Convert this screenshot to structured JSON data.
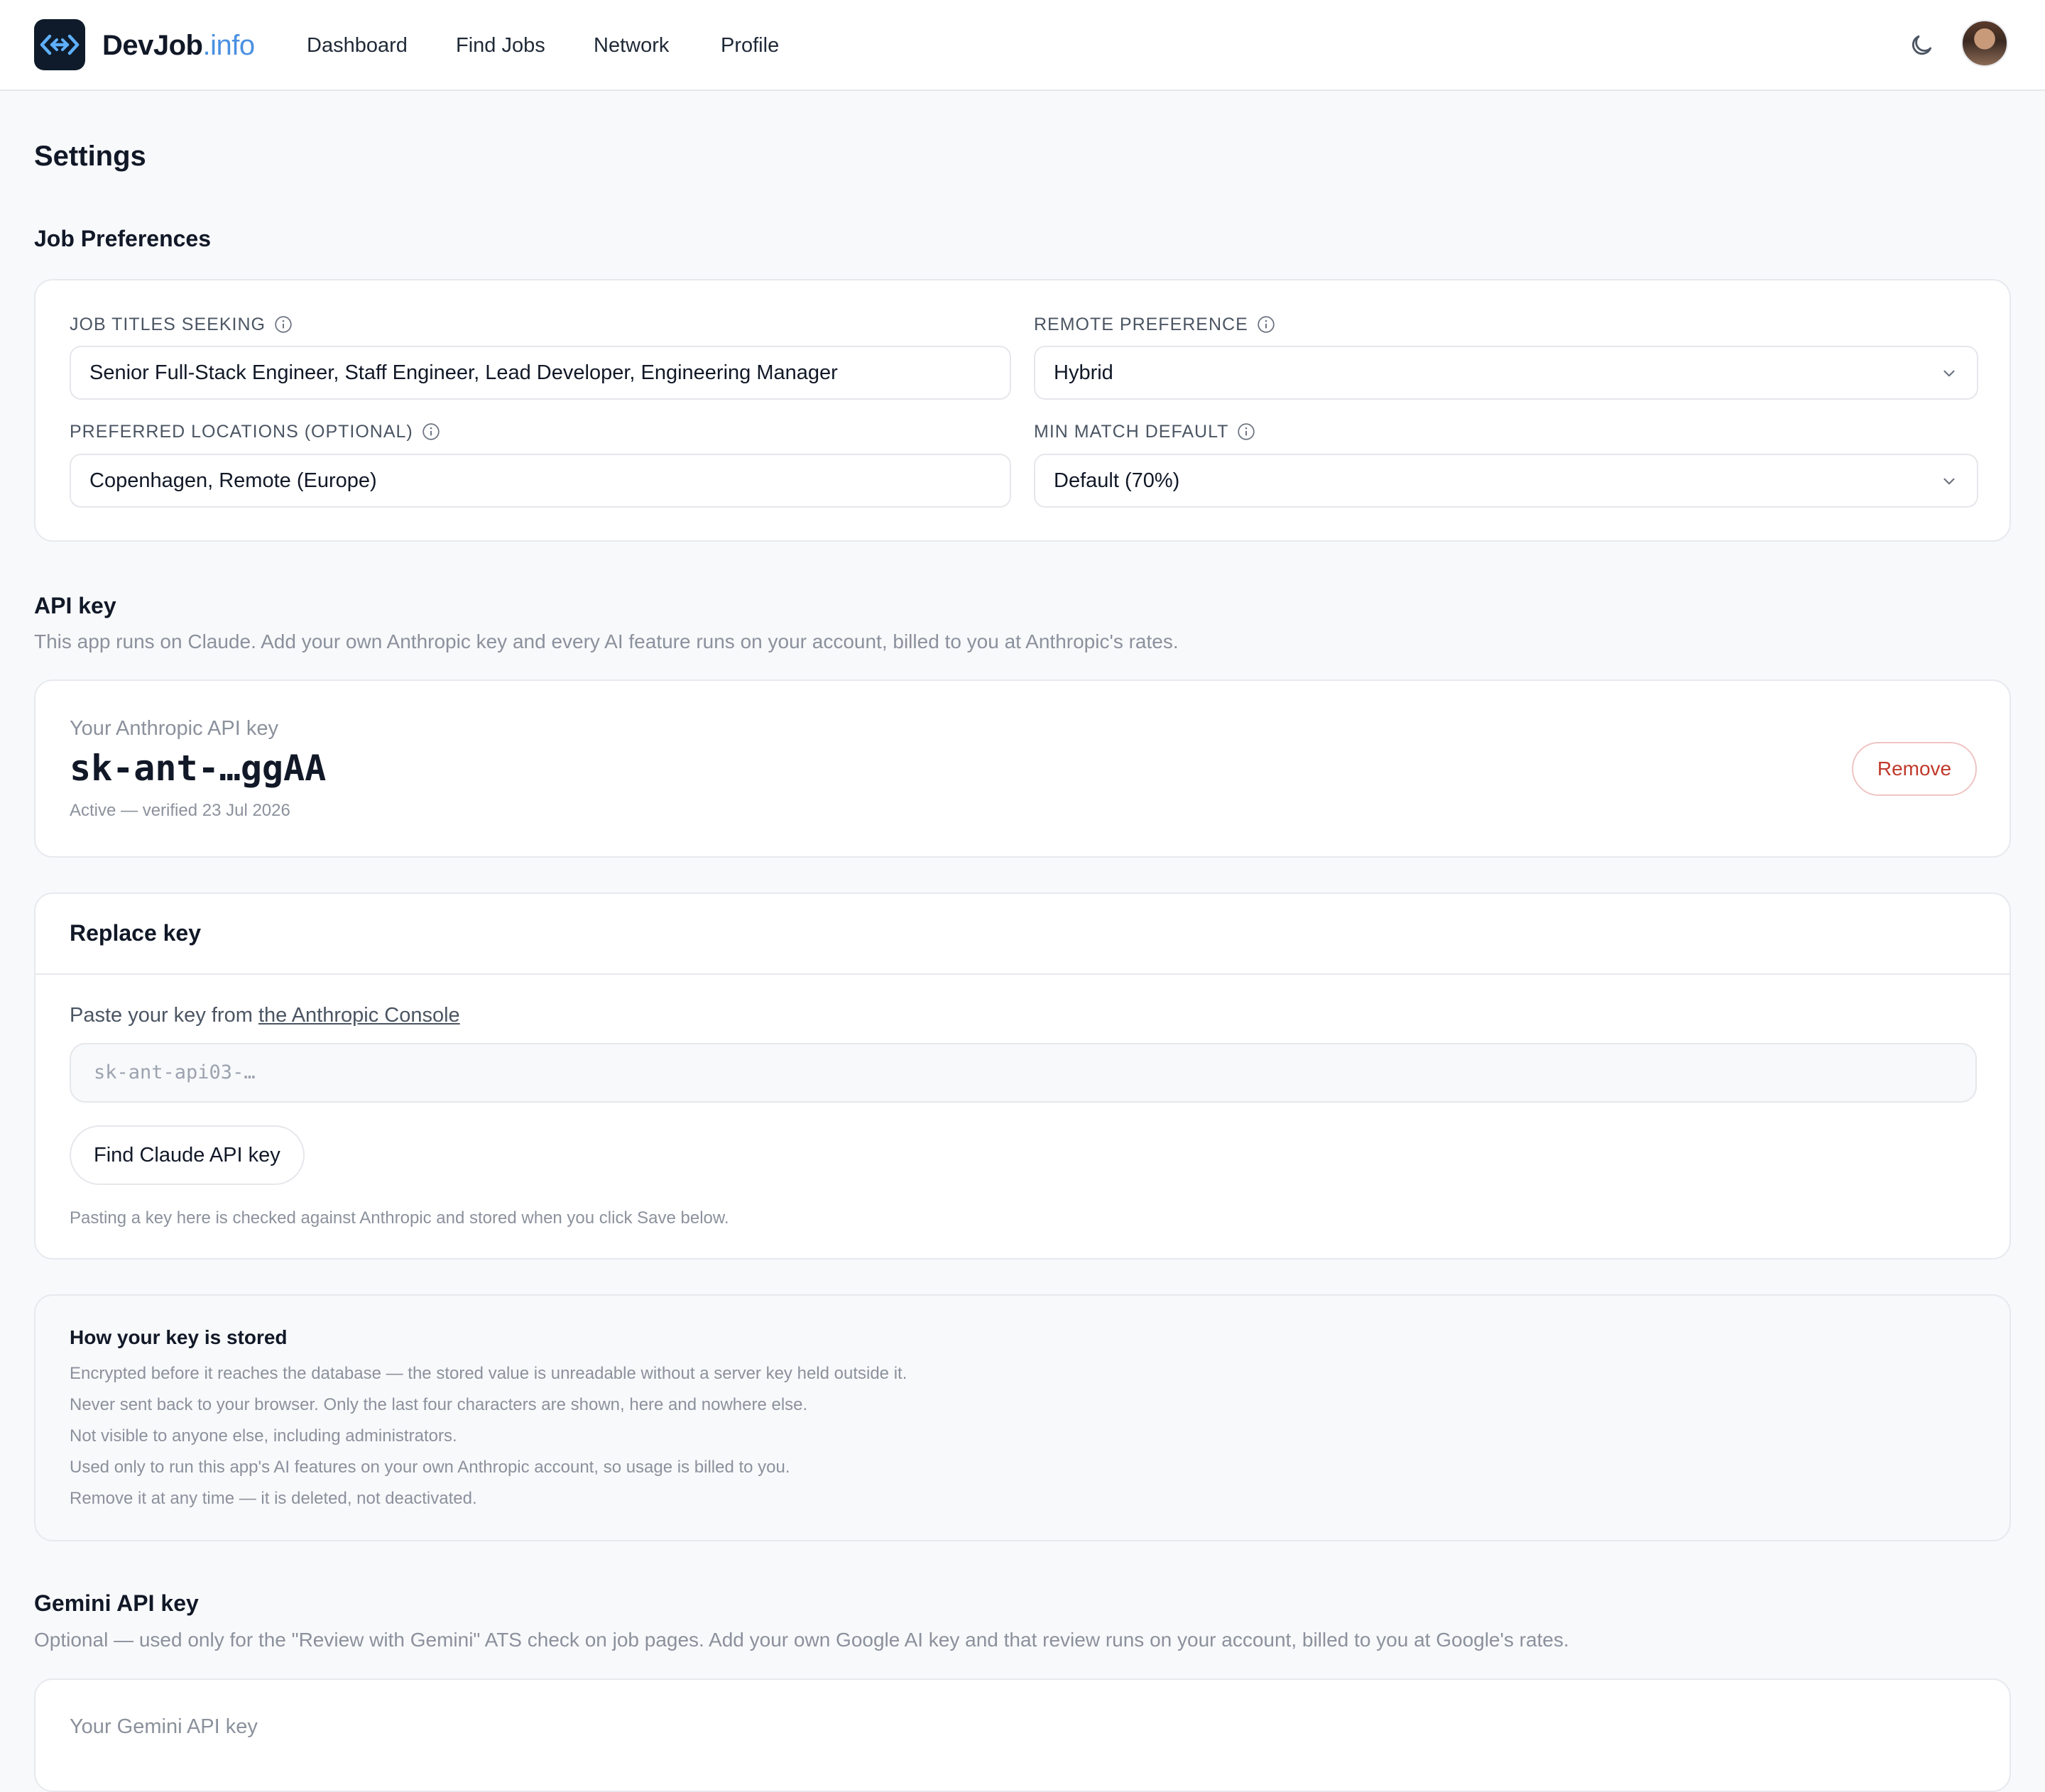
{
  "nav": {
    "brand_main": "DevJob",
    "brand_tld": ".info",
    "links": [
      "Dashboard",
      "Find Jobs",
      "Network",
      "Profile"
    ]
  },
  "page": {
    "title": "Settings"
  },
  "job_prefs": {
    "title": "Job Preferences",
    "job_titles": {
      "label": "JOB TITLES SEEKING",
      "value": "Senior Full-Stack Engineer, Staff Engineer, Lead Developer, Engineering Manager"
    },
    "remote": {
      "label": "REMOTE PREFERENCE",
      "value": "Hybrid"
    },
    "locations": {
      "label": "PREFERRED LOCATIONS (OPTIONAL)",
      "value": "Copenhagen, Remote (Europe)"
    },
    "min_match": {
      "label": "MIN MATCH DEFAULT",
      "value": "Default (70%)"
    }
  },
  "api_key": {
    "title": "API key",
    "description": "This app runs on Claude. Add your own Anthropic key and every AI feature runs on your account, billed to you at Anthropic's rates.",
    "card_label": "Your Anthropic API key",
    "masked_key": "sk-ant-…ggAA",
    "status": "Active — verified 23 Jul 2026",
    "remove_label": "Remove"
  },
  "replace_key": {
    "title": "Replace key",
    "paste_prefix": "Paste your key from ",
    "console_link": "the Anthropic Console",
    "placeholder": "sk-ant-api03-…",
    "find_button": "Find Claude API key",
    "note": "Pasting a key here is checked against Anthropic and stored when you click Save below."
  },
  "storage": {
    "title": "How your key is stored",
    "points": [
      "Encrypted before it reaches the database — the stored value is unreadable without a server key held outside it.",
      "Never sent back to your browser. Only the last four characters are shown, here and nowhere else.",
      "Not visible to anyone else, including administrators.",
      "Used only to run this app's AI features on your own Anthropic account, so usage is billed to you.",
      "Remove it at any time — it is deleted, not deactivated."
    ]
  },
  "gemini": {
    "title": "Gemini API key",
    "description": "Optional — used only for the \"Review with Gemini\" ATS check on job pages. Add your own Google AI key and that review runs on your account, billed to you at Google's rates.",
    "card_label": "Your Gemini API key"
  },
  "colors": {
    "accent": "#4a90e2",
    "danger": "#c0392b",
    "logo_bg": "#0f1b2a"
  },
  "icons": {
    "logo": "code-arrows-icon",
    "theme": "moon-icon",
    "info": "info-icon",
    "dropdown": "chevron-down-icon"
  }
}
